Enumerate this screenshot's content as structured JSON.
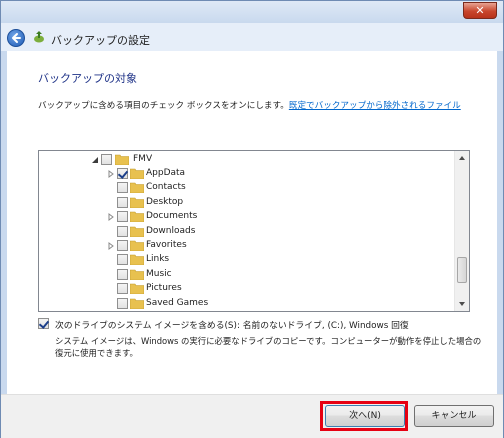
{
  "window": {
    "title": "バックアップの設定",
    "close_label": "✕"
  },
  "page": {
    "section_title": "バックアップの対象",
    "description": "バックアップに含める項目のチェック ボックスをオンにします。",
    "exclusion_link": "既定でバックアップから除外されるファイル"
  },
  "tree": {
    "root": {
      "label": "FMV",
      "expanded": true,
      "checked": false
    },
    "items": [
      {
        "label": "AppData",
        "checked": true,
        "expandable": true
      },
      {
        "label": "Contacts",
        "checked": false,
        "expandable": false
      },
      {
        "label": "Desktop",
        "checked": false,
        "expandable": false
      },
      {
        "label": "Documents",
        "checked": false,
        "expandable": true
      },
      {
        "label": "Downloads",
        "checked": false,
        "expandable": false
      },
      {
        "label": "Favorites",
        "checked": false,
        "expandable": true
      },
      {
        "label": "Links",
        "checked": false,
        "expandable": false
      },
      {
        "label": "Music",
        "checked": false,
        "expandable": false
      },
      {
        "label": "Pictures",
        "checked": false,
        "expandable": false
      },
      {
        "label": "Saved Games",
        "checked": false,
        "expandable": false
      }
    ]
  },
  "system_image": {
    "checked": true,
    "label": "次のドライブのシステム イメージを含める(S): 名前のないドライブ, (C:), Windows 回復",
    "description": "システム イメージは、Windows の実行に必要なドライブのコピーです。コンピューターが動作を停止した場合の復元に使用できます。"
  },
  "buttons": {
    "next": "次へ(N)",
    "cancel": "キャンセル"
  }
}
